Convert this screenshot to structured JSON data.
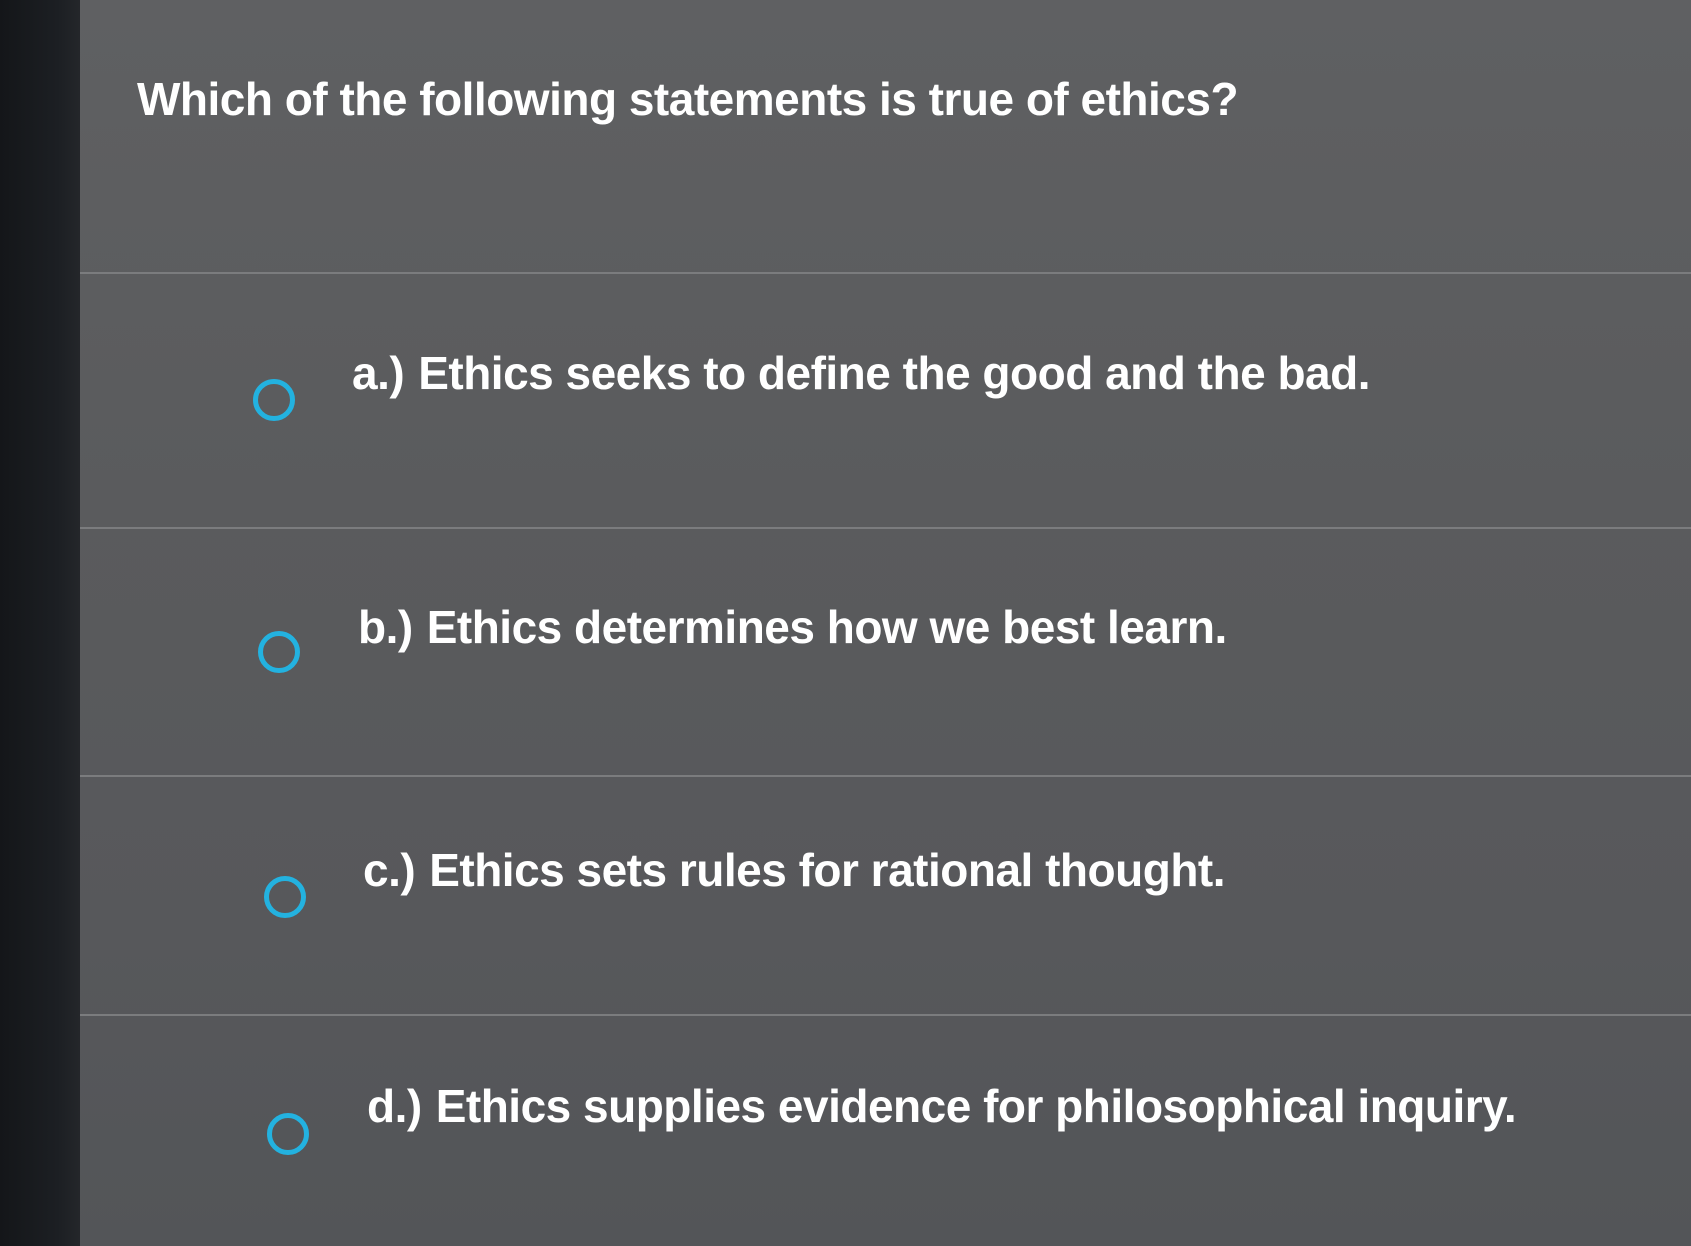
{
  "question": {
    "text": "Which of the following statements is true of ethics?"
  },
  "options": [
    {
      "letter": "a.)",
      "text": "Ethics seeks to define the good and the bad.",
      "icon": "radio-unchecked-icon"
    },
    {
      "letter": "b.)",
      "text": "Ethics determines how we best learn.",
      "icon": "radio-unchecked-icon"
    },
    {
      "letter": "c.)",
      "text": "Ethics sets rules for rational thought.",
      "icon": "radio-unchecked-icon"
    },
    {
      "letter": "d.)",
      "text": "Ethics supplies evidence for philosophical inquiry.",
      "icon": "radio-unchecked-icon"
    }
  ],
  "colors": {
    "radio_accent": "#23b2e0",
    "text": "#ffffff",
    "background": "#5a5b5d"
  }
}
